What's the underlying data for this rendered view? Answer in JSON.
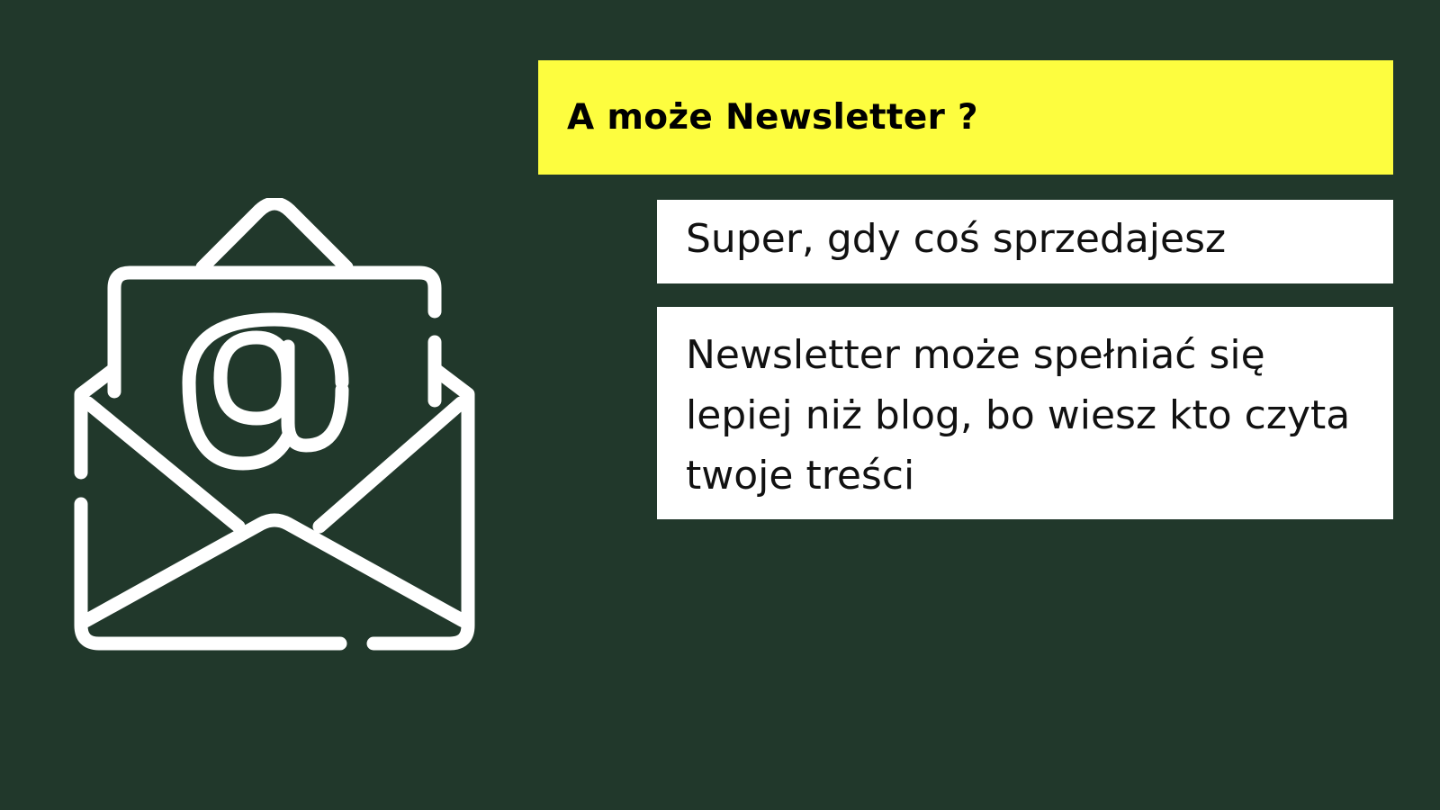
{
  "heading": {
    "title": "A może Newsletter ?"
  },
  "cards": [
    {
      "text": "Super, gdy coś sprzedajesz"
    },
    {
      "text": "Newsletter może spełniać się lepiej niż blog, bo wiesz kto czyta twoje treści"
    }
  ],
  "illustration": {
    "icon": "open-envelope-at-icon"
  },
  "colors": {
    "background": "#21382b",
    "title_background": "#fdfd3f",
    "card_background": "#ffffff",
    "icon_stroke": "#ffffff"
  }
}
